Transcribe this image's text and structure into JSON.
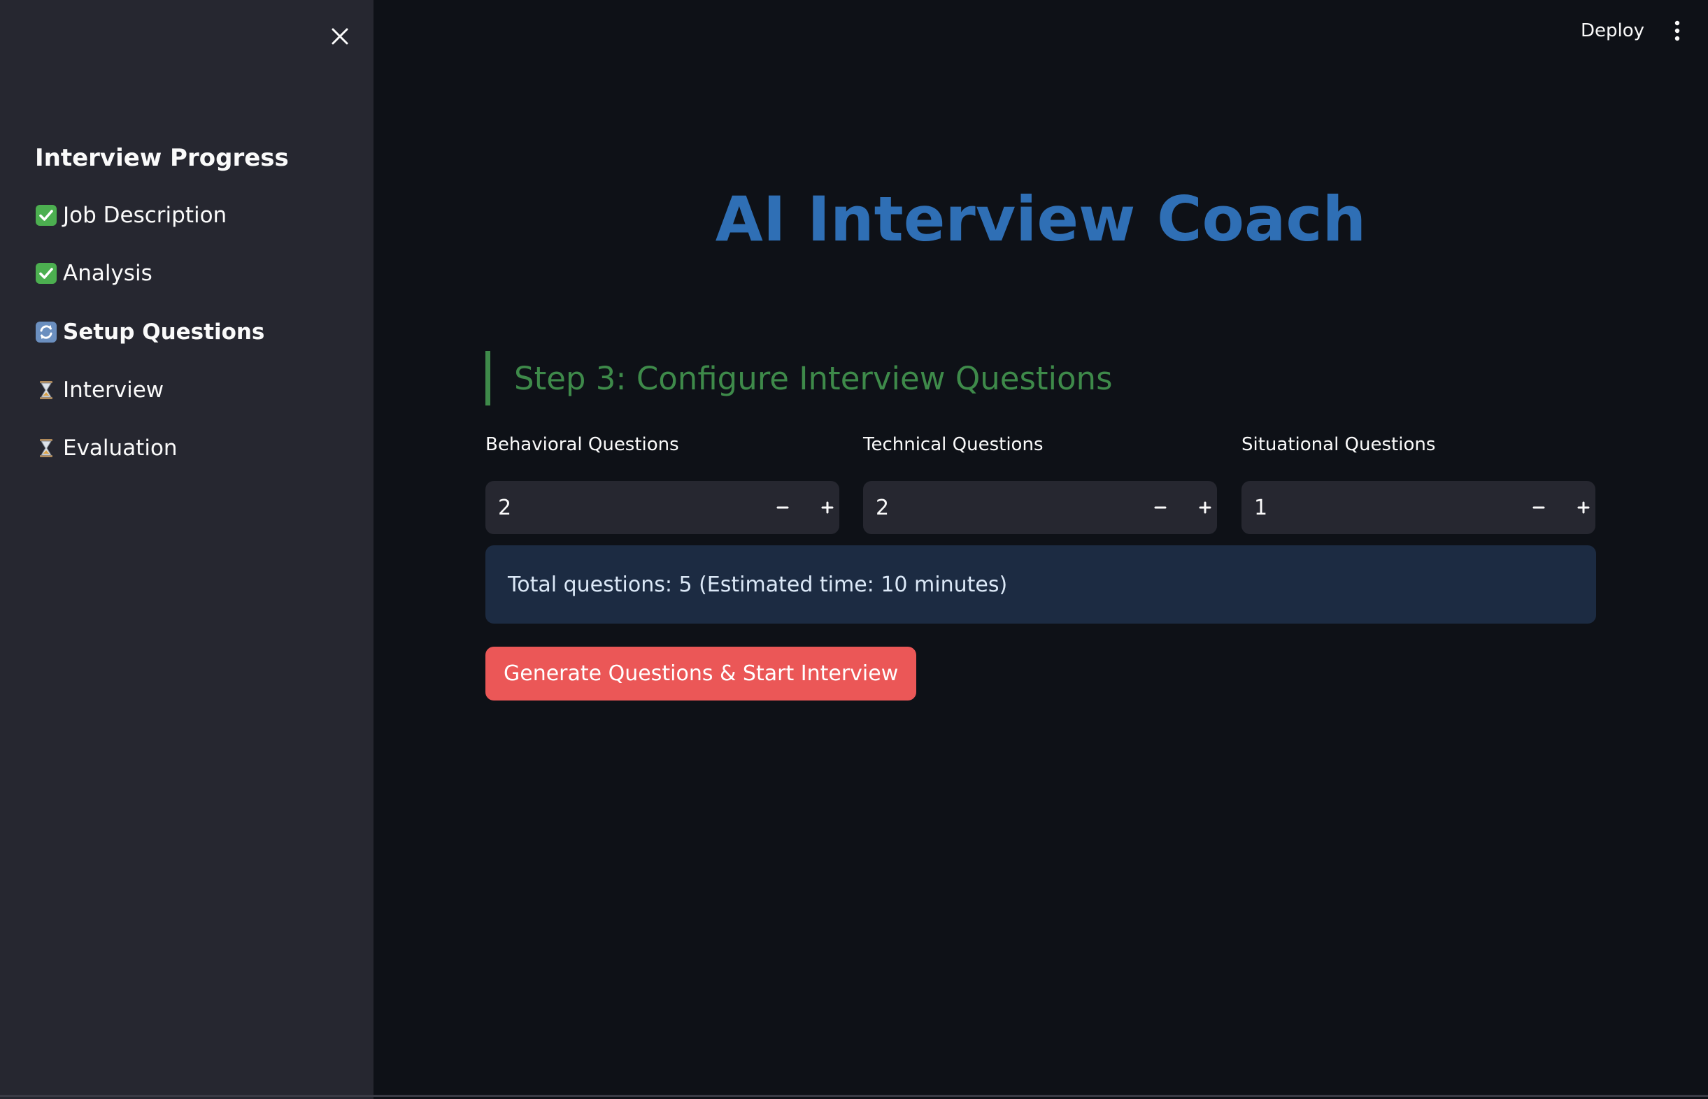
{
  "header": {
    "deploy_label": "Deploy",
    "menu_icon": "kebab-vertical-icon"
  },
  "sidebar": {
    "close_icon": "close-icon",
    "title": "Interview Progress",
    "steps": [
      {
        "label": "Job Description",
        "status": "completed",
        "icon": "check-icon"
      },
      {
        "label": "Analysis",
        "status": "completed",
        "icon": "check-icon"
      },
      {
        "label": "Setup Questions",
        "status": "in-progress",
        "icon": "refresh-icon"
      },
      {
        "label": "Interview",
        "status": "pending",
        "icon": "hourglass-icon"
      },
      {
        "label": "Evaluation",
        "status": "pending",
        "icon": "hourglass-icon"
      }
    ]
  },
  "main": {
    "title": "AI Interview Coach",
    "step_header": "Step 3: Configure Interview Questions",
    "fields": [
      {
        "label": "Behavioral Questions",
        "value": "2"
      },
      {
        "label": "Technical Questions",
        "value": "2"
      },
      {
        "label": "Situational Questions",
        "value": "1"
      }
    ],
    "info_text": "Total questions: 5 (Estimated time: 10 minutes)",
    "primary_button": "Generate Questions & Start Interview"
  },
  "colors": {
    "background": "#0e1117",
    "sidebar": "#262730",
    "title": "#2f6fb5",
    "step_header": "#3e8a4a",
    "info_bg": "#1c2b42",
    "primary": "#eb5757"
  }
}
